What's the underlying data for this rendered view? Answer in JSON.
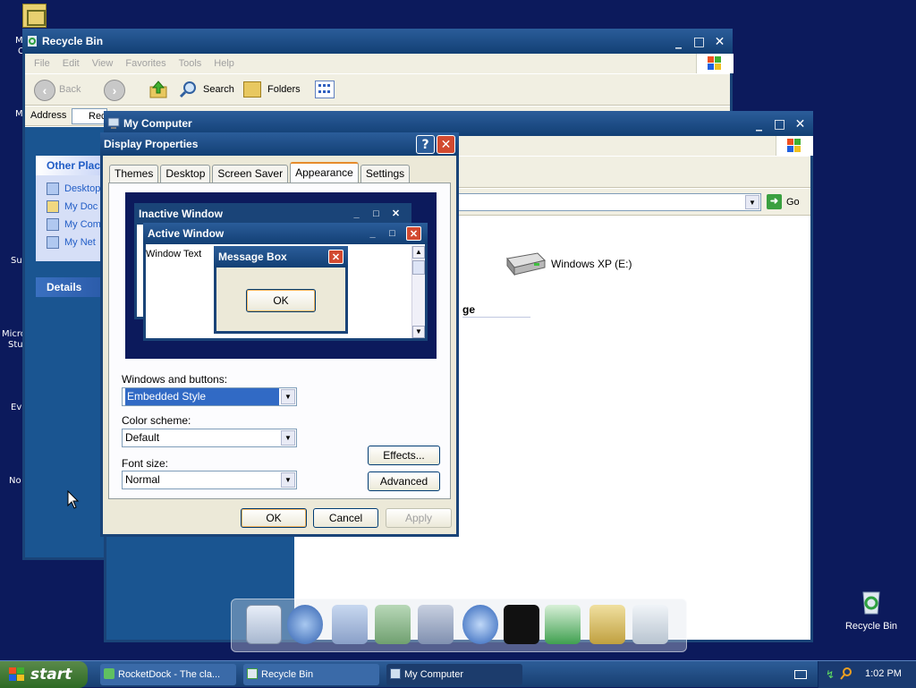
{
  "desktop": {
    "left_fragments": [
      "M",
      "C",
      "M",
      "Su",
      "Micro",
      "Stu",
      "Ev",
      "No"
    ],
    "recycle_bin_label": "Recycle Bin"
  },
  "recycle_window": {
    "title": "Recycle Bin",
    "menu": [
      "File",
      "Edit",
      "View",
      "Favorites",
      "Tools",
      "Help"
    ],
    "back_label": "Back",
    "search_label": "Search",
    "folders_label": "Folders",
    "address_label": "Address",
    "address_value": "Rec",
    "other_places_title": "Other Plac",
    "other_places": [
      "Desktop",
      "My Doc",
      "My Com",
      "My Net"
    ],
    "details_title": "Details"
  },
  "mycomputer_window": {
    "title": "My Computer",
    "go_label": "Go",
    "drive_label": "Windows XP (E:)",
    "section_fragment": "ge"
  },
  "display_dialog": {
    "title": "Display Properties",
    "tabs": [
      "Themes",
      "Desktop",
      "Screen Saver",
      "Appearance",
      "Settings"
    ],
    "active_tab": "Appearance",
    "preview": {
      "inactive_title": "Inactive Window",
      "active_title": "Active Window",
      "window_text": "Window Text",
      "msgbox_title": "Message Box",
      "msgbox_ok": "OK"
    },
    "windows_buttons_label": "Windows and buttons:",
    "windows_buttons_value": "Embedded Style",
    "color_scheme_label": "Color scheme:",
    "color_scheme_value": "Default",
    "font_size_label": "Font size:",
    "font_size_value": "Normal",
    "effects_label": "Effects...",
    "advanced_label": "Advanced",
    "ok_label": "OK",
    "cancel_label": "Cancel",
    "apply_label": "Apply"
  },
  "taskbar": {
    "start_label": "start",
    "items": [
      "RocketDock - The cla...",
      "Recycle Bin",
      "My Computer"
    ],
    "clock": "1:02 PM"
  },
  "dock_icons": [
    "monitor-icon",
    "globe-network-icon",
    "documents-folder-icon",
    "music-folder-icon",
    "pictures-folder-icon",
    "internet-globe-icon",
    "tshirt-icon",
    "recycle-icon",
    "tools-icon",
    "trash-can-icon"
  ],
  "colors": {
    "desktop_bg": "#0c1a5c",
    "title_blue": "#1a4478",
    "close_red": "#d24a30",
    "dialog_bg": "#ece9d8",
    "selection": "#316ac5"
  }
}
